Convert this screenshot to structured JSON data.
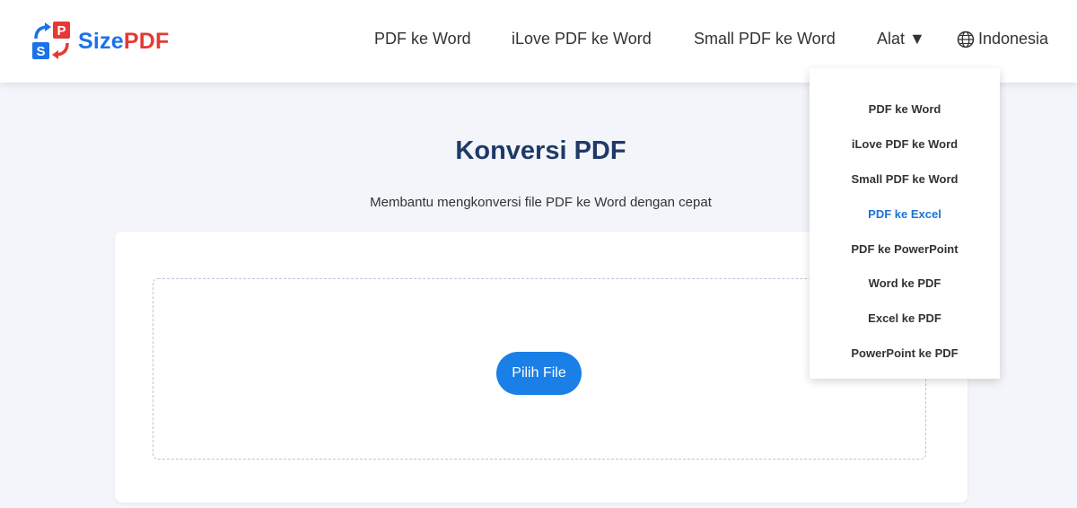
{
  "brand": {
    "logo_icon": "sizepdf-logo-icon",
    "name_part1": "Size",
    "name_part2": "PDF",
    "color_part1": "#1a73e8",
    "color_part2": "#e53935"
  },
  "nav": {
    "items": [
      {
        "label": "PDF ke Word"
      },
      {
        "label": "iLove PDF ke Word"
      },
      {
        "label": "Small PDF ke Word"
      },
      {
        "label": "Alat ▼"
      }
    ],
    "language": {
      "icon": "globe-icon",
      "label": "Indonesia"
    }
  },
  "main": {
    "title": "Konversi PDF",
    "subtitle": "Membantu mengkonversi file PDF ke Word dengan cepat",
    "pick_file_label": "Pilih File"
  },
  "dropdown": {
    "items": [
      {
        "label": "PDF ke Word"
      },
      {
        "label": "iLove PDF ke Word"
      },
      {
        "label": "Small PDF ke Word"
      },
      {
        "label": "PDF ke Excel",
        "active": true
      },
      {
        "label": "PDF ke PowerPoint"
      },
      {
        "label": "Word ke PDF"
      },
      {
        "label": "Excel ke PDF"
      },
      {
        "label": "PowerPoint ke PDF"
      }
    ]
  },
  "colors": {
    "accent": "#1a7fe6",
    "title": "#1f3a68",
    "active_menu": "#1a73d9"
  }
}
